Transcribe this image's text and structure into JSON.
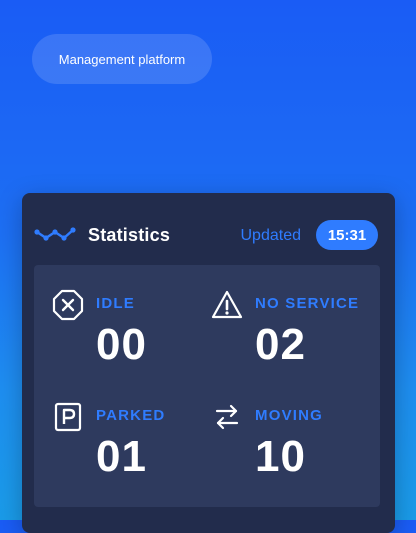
{
  "brand": {
    "label": "Management platform"
  },
  "card": {
    "title": "Statistics",
    "updated_label": "Updated",
    "updated_time": "15:31",
    "icon": "trend-line-icon"
  },
  "stats": [
    {
      "label": "IDLE",
      "value": "00",
      "icon": "octagon-x-icon"
    },
    {
      "label": "NO SERVICE",
      "value": "02",
      "icon": "warning-triangle-icon"
    },
    {
      "label": "PARKED",
      "value": "01",
      "icon": "parking-icon"
    },
    {
      "label": "MOVING",
      "value": "10",
      "icon": "swap-arrows-icon"
    }
  ],
  "colors": {
    "accent": "#2f7cff",
    "card_bg": "#222c4c",
    "panel_bg": "#2e3a5e",
    "text": "#ffffff"
  }
}
